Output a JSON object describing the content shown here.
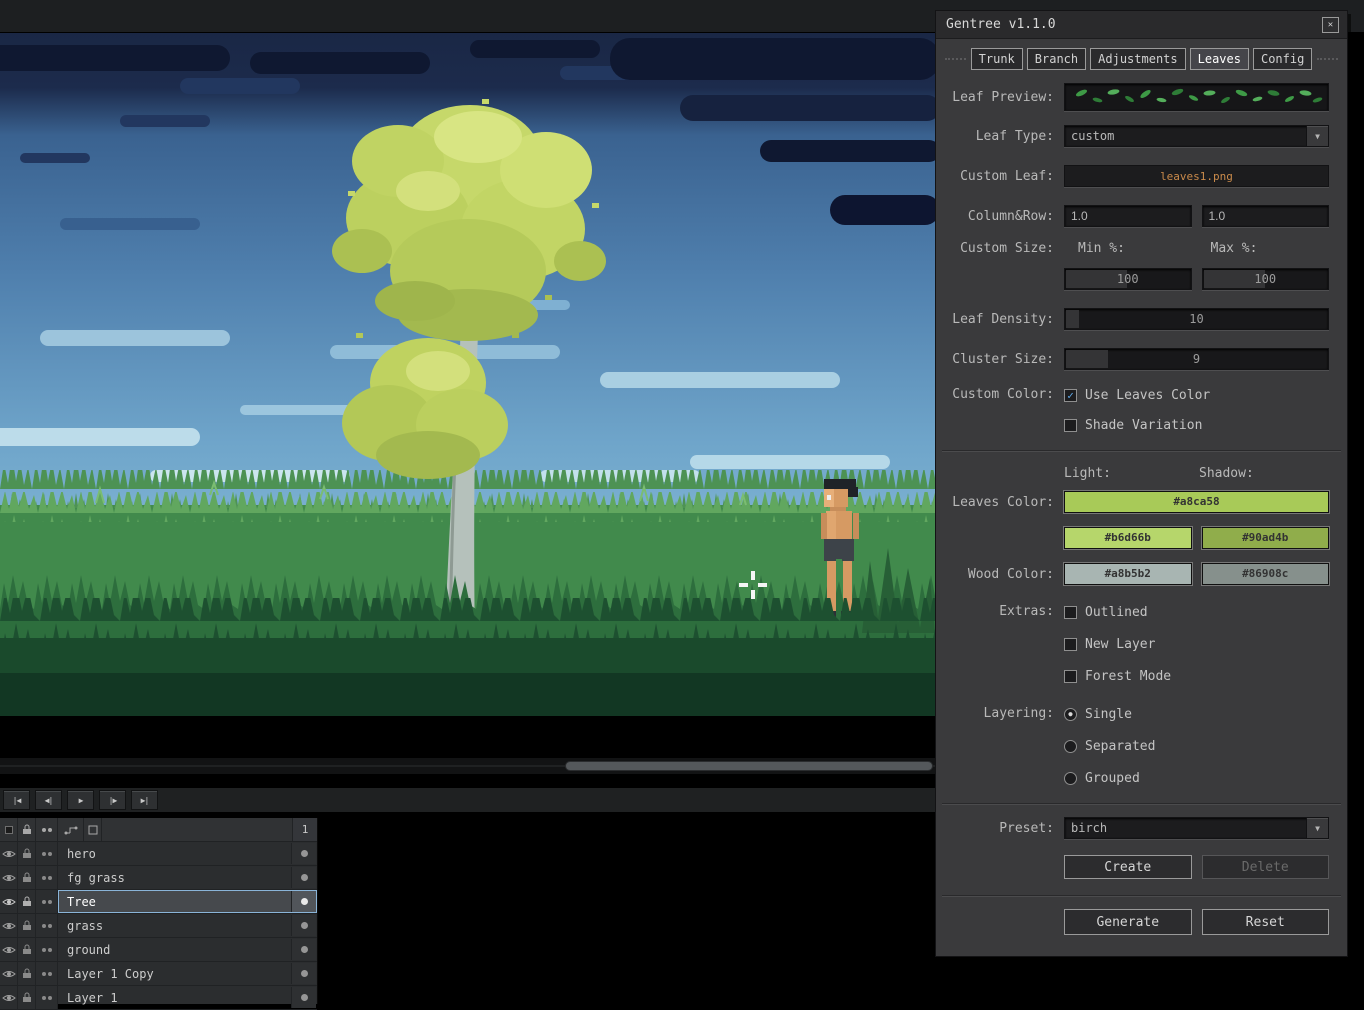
{
  "dialog": {
    "title": "Gentree v1.1.0",
    "icons": {
      "close": "✕",
      "dropdown": "▼"
    },
    "tabs": [
      "Trunk",
      "Branch",
      "Adjustments",
      "Leaves",
      "Config"
    ],
    "active_tab": "Leaves",
    "leaf_preview": {
      "label": "Leaf Preview:"
    },
    "leaf_type": {
      "label": "Leaf Type:",
      "value": "custom"
    },
    "custom_leaf": {
      "label": "Custom Leaf:",
      "value": "leaves1.png"
    },
    "column_row": {
      "label": "Column&Row:",
      "col": "1.0",
      "row": "1.0"
    },
    "custom_size": {
      "label": "Custom Size:",
      "min_label": "Min %:",
      "max_label": "Max %:",
      "min": "100",
      "max": "100"
    },
    "leaf_density": {
      "label": "Leaf Density:",
      "value": "10"
    },
    "cluster_size": {
      "label": "Cluster Size:",
      "value": "9"
    },
    "custom_color": {
      "label": "Custom Color:",
      "use_leaves_color": {
        "label": "Use Leaves Color",
        "checked": true,
        "mark": "✓"
      },
      "shade_variation": {
        "label": "Shade Variation",
        "checked": false,
        "mark": ""
      }
    },
    "colors": {
      "light_label": "Light:",
      "shadow_label": "Shadow:",
      "leaves_label": "Leaves Color:",
      "leaves_main": "#a8ca58",
      "leaves_light": "#b6d66b",
      "leaves_shadow": "#90ad4b",
      "wood_label": "Wood Color:",
      "wood_light": "#a8b5b2",
      "wood_shadow": "#86908c"
    },
    "extras": {
      "label": "Extras:",
      "options": [
        {
          "label": "Outlined",
          "mark": ""
        },
        {
          "label": "New Layer",
          "mark": ""
        },
        {
          "label": "Forest Mode",
          "mark": ""
        }
      ]
    },
    "layering": {
      "label": "Layering:",
      "options": [
        {
          "label": "Single",
          "dot": "●"
        },
        {
          "label": "Separated",
          "dot": ""
        },
        {
          "label": "Grouped",
          "dot": ""
        }
      ]
    },
    "preset": {
      "label": "Preset:",
      "value": "birch",
      "create": "Create",
      "delete": "Delete"
    },
    "actions": {
      "generate": "Generate",
      "reset": "Reset"
    }
  },
  "timeline": {
    "controls": {
      "first": "|◀",
      "prev": "◀|",
      "play": "▶",
      "next": "|▶",
      "last": "▶|"
    },
    "frame_header": "1",
    "layers": [
      {
        "name": "hero",
        "selected": false
      },
      {
        "name": "fg grass",
        "selected": false
      },
      {
        "name": "Tree",
        "selected": true
      },
      {
        "name": "grass",
        "selected": false
      },
      {
        "name": "ground",
        "selected": false
      },
      {
        "name": "Layer 1 Copy",
        "selected": false
      },
      {
        "name": "Layer 1",
        "selected": false
      }
    ]
  }
}
